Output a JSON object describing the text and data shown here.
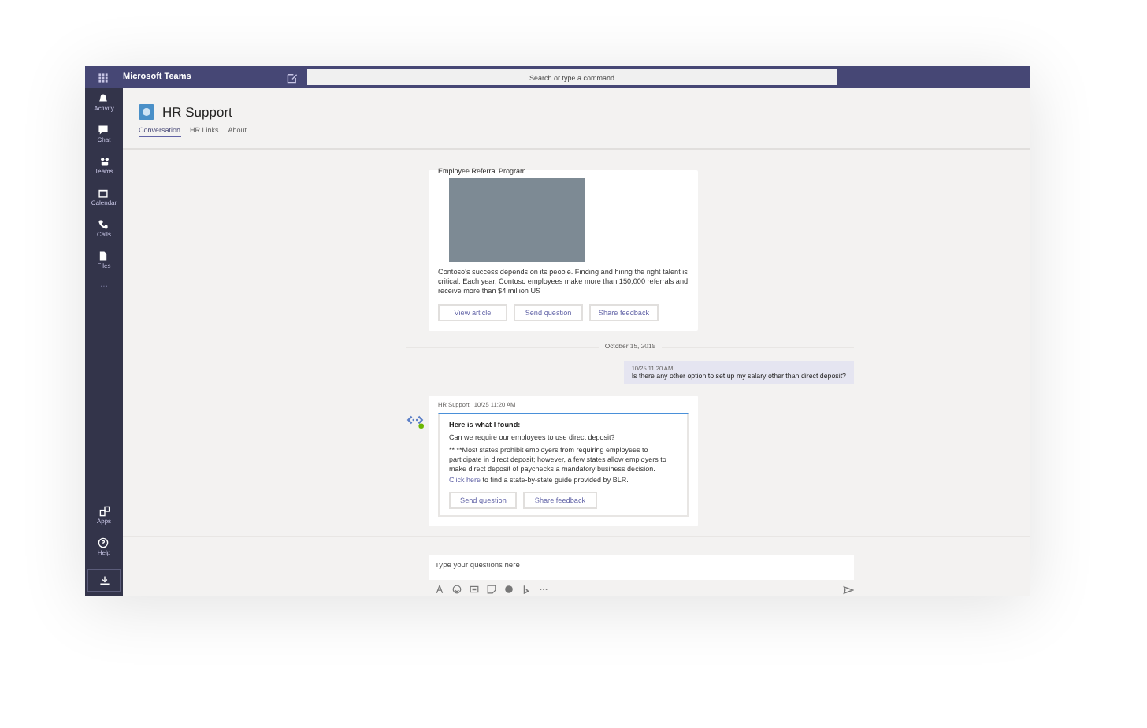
{
  "window": {
    "title": "Microsoft Teams"
  },
  "search": {
    "placeholder": "Search or type a command"
  },
  "rail": {
    "top": [
      {
        "label": "Activity"
      },
      {
        "label": "Chat"
      },
      {
        "label": "Teams"
      },
      {
        "label": "Calendar"
      },
      {
        "label": "Calls"
      },
      {
        "label": "Files"
      }
    ],
    "more": "···",
    "bottom": [
      {
        "label": "Apps"
      },
      {
        "label": "Help"
      }
    ]
  },
  "channel": {
    "name": "HR Support",
    "tabs": [
      {
        "label": "Conversation",
        "selected": true
      },
      {
        "label": "HR Links",
        "selected": false
      },
      {
        "label": "About",
        "selected": false
      }
    ]
  },
  "article_card": {
    "title": "Employee Referral Program",
    "body": "Contoso's success depends on its people. Finding and hiring the right talent is critical. Each year, Contoso employees make more than 150,000 referrals and receive more than $4 million US",
    "buttons": [
      "View article",
      "Send question",
      "Share feedback"
    ]
  },
  "date_divider": "October 15, 2018",
  "user_message": {
    "time": "10/25 11:20 AM",
    "text": "Is there any other option to set up my salary other than direct deposit?"
  },
  "bot_message": {
    "sender": "HR Support",
    "time": "10/25 11:20 AM",
    "heading": "Here is what I found:",
    "question": "Can we require our employees to use direct deposit?",
    "answer": "** **Most states prohibit employers from requiring employees to participate in direct deposit; however, a few states allow employers to make direct deposit of paychecks a mandatory business decision.",
    "link": "Click here",
    "answer_end": "to find a state-by-state guide provided by BLR.",
    "buttons": [
      "Send question",
      "Share feedback"
    ]
  },
  "compose": {
    "placeholder": "Type your questions here"
  }
}
